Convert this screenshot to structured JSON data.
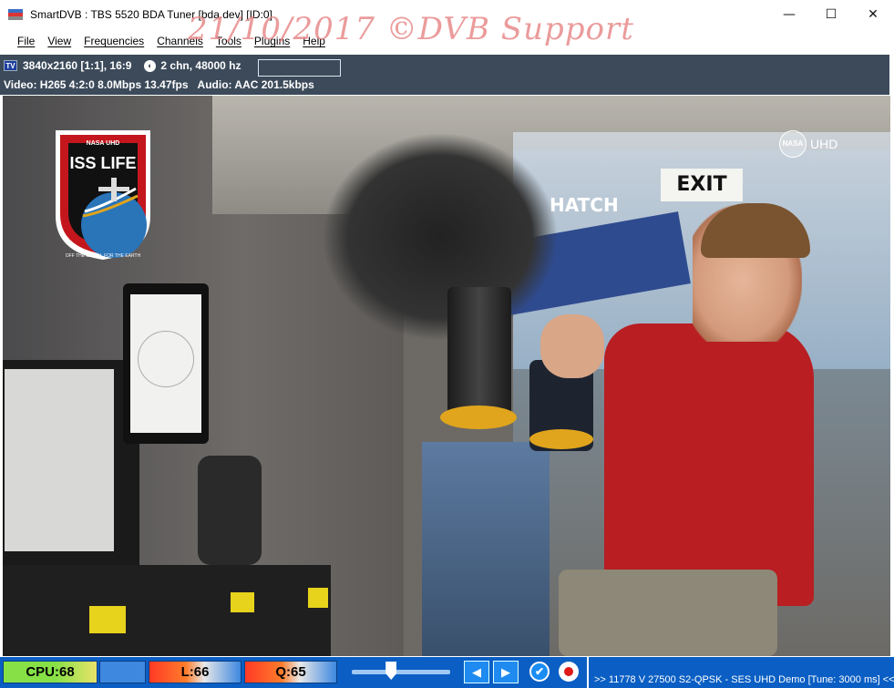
{
  "window": {
    "title": "SmartDVB : TBS 5520 BDA Tuner [bda.dev]  [ID:0]",
    "controls": {
      "minimize": "—",
      "maximize": "☐",
      "close": "✕"
    }
  },
  "watermark": "21/10/2017   ©DVB Support",
  "menu": [
    "File",
    "View",
    "Frequencies",
    "Channels",
    "Tools",
    "Plugins",
    "Help"
  ],
  "info": {
    "tv_icon": "TV",
    "resolution": "3840x2160 [1:1], 16:9",
    "audio_info": "2 chn, 48000 hz",
    "video": "Video: H265  4:2:0  8.0Mbps  13.47fps",
    "audio": "Audio: AAC  201.5kbps"
  },
  "video_overlay": {
    "nasa_label": "NASA",
    "uhd_label": "UHD",
    "badge_top": "NASA UHD",
    "badge_title": "ISS LIFE",
    "badge_ring": "OFF THE EARTH, FOR THE EARTH",
    "exit_sign": "EXIT",
    "hatch_sign": "HATCH"
  },
  "status": {
    "cpu": "CPU:68",
    "level": "L:66",
    "quality": "Q:65",
    "volume_level": 0.4,
    "prev_icon": "◀",
    "next_icon": "▶",
    "check_icon": "✔",
    "tune_text": ">> 11778 V 27500 S2-QPSK - SES UHD Demo [Tune: 3000 ms] <<"
  },
  "colors": {
    "statusbar": "#0b5fc4",
    "infobar": "#3c4a5a",
    "watermark": "#e88a8a"
  }
}
